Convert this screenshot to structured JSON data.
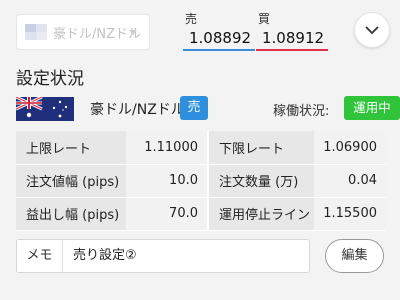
{
  "header": {
    "pair_select_label": "豪ドル/NZドル",
    "sell_label": "売",
    "sell_rate": "1.08892",
    "buy_label": "買",
    "buy_rate": "1.08912"
  },
  "status": {
    "section_title": "設定状況",
    "pair_name": "豪ドル/NZドル",
    "side": "売",
    "operation_label": "稼働状況:",
    "operation_value": "運用中"
  },
  "settings": {
    "rows": [
      {
        "label1": "上限レート",
        "value1": "1.11000",
        "label2": "下限レート",
        "value2": "1.06900"
      },
      {
        "label1": "注文値幅 (pips)",
        "value1": "10.0",
        "label2": "注文数量 (万)",
        "value2": "0.04"
      },
      {
        "label1": "益出し幅 (pips)",
        "value1": "70.0",
        "label2": "運用停止ライン",
        "value2": "1.15500"
      }
    ]
  },
  "memo": {
    "label": "メモ",
    "value": "売り設定②"
  },
  "edit_label": "編集",
  "colors": {
    "sell_badge": "#2d8fde",
    "operation_badge": "#2fc43a",
    "sell_underline": "#3a8ed8",
    "buy_underline": "#e0304a"
  },
  "icons": {
    "pair_flag": "australia-flag-icon",
    "toggle": "chevron-down-icon"
  }
}
